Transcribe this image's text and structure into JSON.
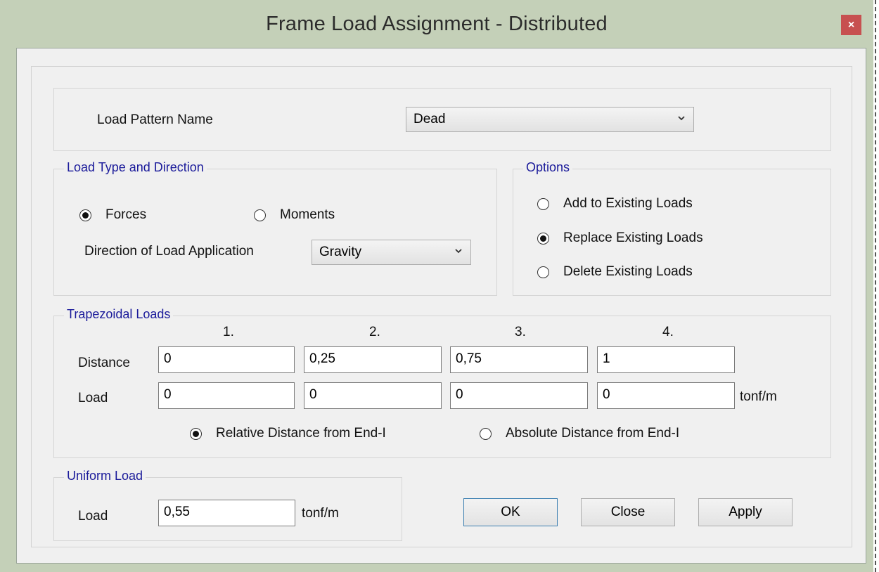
{
  "window": {
    "title": "Frame Load Assignment - Distributed",
    "close_glyph": "×"
  },
  "load_pattern": {
    "label": "Load Pattern Name",
    "value": "Dead"
  },
  "load_type": {
    "legend": "Load Type and Direction",
    "forces_label": "Forces",
    "moments_label": "Moments",
    "selected": "forces",
    "direction_label": "Direction of Load Application",
    "direction_value": "Gravity"
  },
  "options": {
    "legend": "Options",
    "items": [
      {
        "label": "Add to Existing Loads",
        "checked": false
      },
      {
        "label": "Replace Existing Loads",
        "checked": true
      },
      {
        "label": "Delete Existing Loads",
        "checked": false
      }
    ]
  },
  "trapezoidal": {
    "legend": "Trapezoidal Loads",
    "columns": [
      "1.",
      "2.",
      "3.",
      "4."
    ],
    "distance_label": "Distance",
    "distances": [
      "0",
      "0,25",
      "0,75",
      "1"
    ],
    "load_label": "Load",
    "loads": [
      "0",
      "0",
      "0",
      "0"
    ],
    "unit": "tonf/m",
    "relative_label": "Relative Distance from End-I",
    "absolute_label": "Absolute Distance from End-I",
    "distance_mode": "relative"
  },
  "uniform": {
    "legend": "Uniform Load",
    "load_label": "Load",
    "value": "0,55",
    "unit": "tonf/m"
  },
  "buttons": {
    "ok": "OK",
    "close": "Close",
    "apply": "Apply"
  },
  "colors": {
    "title_bar": "#c4d0b8",
    "close_button": "#c75050",
    "legend_text": "#1a1a9a",
    "dialog_bg": "#f0f0f0"
  }
}
